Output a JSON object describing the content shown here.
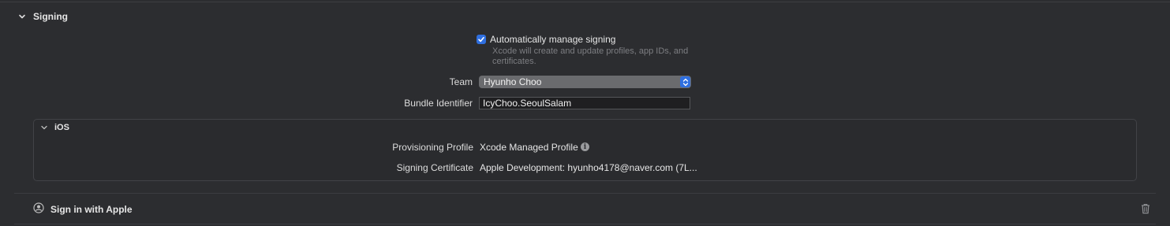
{
  "signing": {
    "title": "Signing",
    "auto_manage_label": "Automatically manage signing",
    "auto_manage_checked": true,
    "auto_manage_help": "Xcode will create and update profiles, app IDs, and certificates.",
    "team_label": "Team",
    "team_value": "Hyunho Choo",
    "bundle_id_label": "Bundle Identifier",
    "bundle_id_value": "IcyChoo.SeoulSalam"
  },
  "ios": {
    "title": "iOS",
    "provisioning_label": "Provisioning Profile",
    "provisioning_value": "Xcode Managed Profile",
    "certificate_label": "Signing Certificate",
    "certificate_value": "Apple Development: hyunho4178@naver.com (7L..."
  },
  "capability": {
    "title": "Sign in with Apple"
  },
  "icons": {
    "section_toggle": "chevron-down-icon",
    "ios_toggle": "chevron-down-icon",
    "checkbox": "checkmark-icon",
    "team_popup": "up-down-chevron-icon",
    "info": "info-icon",
    "capability": "person-circle-icon",
    "delete": "trash-icon"
  },
  "colors": {
    "background": "#2c2d30",
    "accent": "#2f6fe0",
    "muted_text": "#7d7e82"
  }
}
